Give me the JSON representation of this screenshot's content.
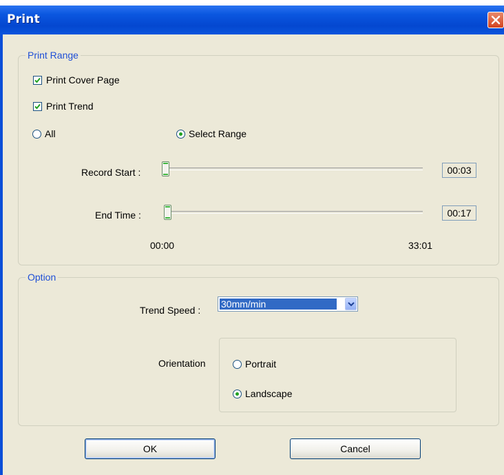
{
  "window": {
    "title": "Print"
  },
  "print_range": {
    "label": "Print Range",
    "print_cover_page": {
      "label": "Print Cover Page",
      "checked": true
    },
    "print_trend": {
      "label": "Print Trend",
      "checked": true
    },
    "range_all": {
      "label": "All",
      "selected": false
    },
    "range_select": {
      "label": "Select Range",
      "selected": true
    },
    "record_start": {
      "label": "Record Start :",
      "value": "00:03",
      "position": 0.0015
    },
    "end_time": {
      "label": "End Time :",
      "value": "00:17",
      "position": 0.0086
    },
    "scale_min": "00:00",
    "scale_max": "33:01"
  },
  "option": {
    "label": "Option",
    "trend_speed": {
      "label": "Trend Speed :",
      "value": "30mm/min"
    },
    "orientation": {
      "label": "Orientation",
      "portrait": {
        "label": "Portrait",
        "selected": false
      },
      "landscape": {
        "label": "Landscape",
        "selected": true
      }
    }
  },
  "buttons": {
    "ok": "OK",
    "cancel": "Cancel"
  },
  "icons": {
    "close": "close-icon",
    "checkbox": "checkmark-icon",
    "dropdown": "chevron-down-icon"
  },
  "colors": {
    "titlebar": "#0b57e0",
    "group_label": "#1f4fd6",
    "check": "#21a121",
    "selection": "#316ac5",
    "close_button": "#d4421e"
  }
}
